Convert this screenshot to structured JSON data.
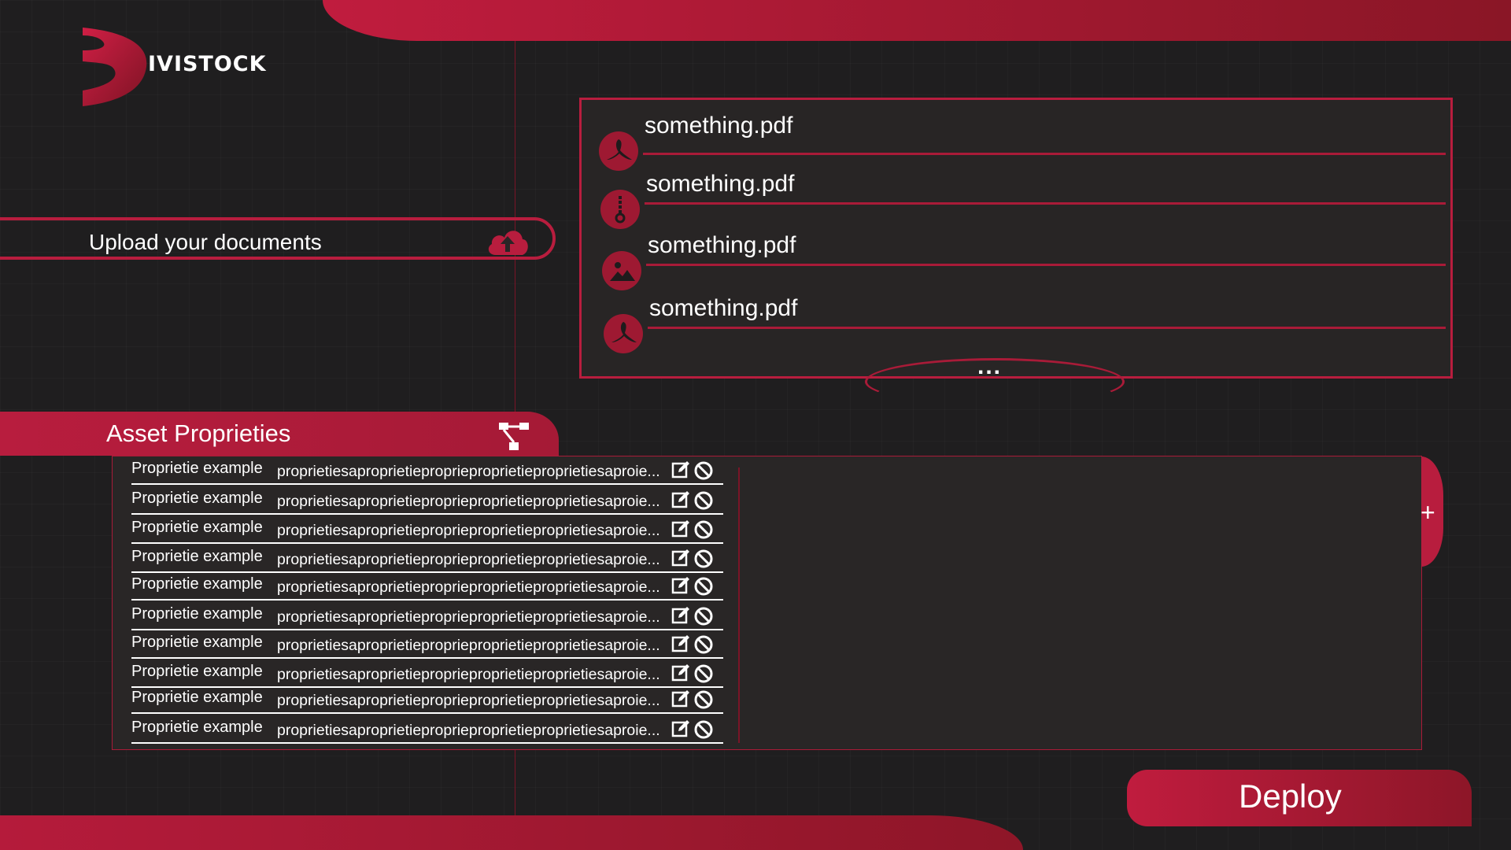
{
  "brand": {
    "name": "IVISTOCK"
  },
  "upload": {
    "label": "Upload your documents",
    "icon": "cloud-upload-icon"
  },
  "files": [
    {
      "name": "something.pdf",
      "icon": "pdf-icon"
    },
    {
      "name": "something.pdf",
      "icon": "zip-icon"
    },
    {
      "name": "something.pdf",
      "icon": "image-icon"
    },
    {
      "name": "something.pdf",
      "icon": "pdf-icon"
    }
  ],
  "files_more": "...",
  "asset": {
    "title": "Asset Proprieties",
    "icon": "hierarchy-icon",
    "rows": [
      {
        "name": "Proprietie example",
        "value": "proprietiesaproprietieproprieproprietieproprietiesaproie..."
      },
      {
        "name": "Proprietie example",
        "value": "proprietiesaproprietieproprieproprietieproprietiesaproie..."
      },
      {
        "name": "Proprietie example",
        "value": "proprietiesaproprietieproprieproprietieproprietiesaproie..."
      },
      {
        "name": "Proprietie example",
        "value": "proprietiesaproprietieproprieproprietieproprietiesaproie..."
      },
      {
        "name": "Proprietie example",
        "value": "proprietiesaproprietieproprieproprietieproprietiesaproie..."
      },
      {
        "name": "Proprietie example",
        "value": "proprietiesaproprietieproprieproprietieproprietiesaproie..."
      },
      {
        "name": "Proprietie example",
        "value": "proprietiesaproprietieproprieproprietieproprietiesaproie..."
      },
      {
        "name": "Proprietie example",
        "value": "proprietiesaproprietieproprieproprietieproprietiesaproie..."
      },
      {
        "name": "Proprietie example",
        "value": "proprietiesaproprietieproprieproprietieproprietiesaproie..."
      },
      {
        "name": "Proprietie example",
        "value": "proprietiesaproprietieproprieproprietieproprietiesaproie..."
      }
    ],
    "add_label": "+"
  },
  "deploy": {
    "label": "Deploy"
  },
  "colors": {
    "accent": "#b81d3e",
    "accent_dark": "#8a1626",
    "background": "#1f1e1f",
    "panel": "#282525"
  }
}
